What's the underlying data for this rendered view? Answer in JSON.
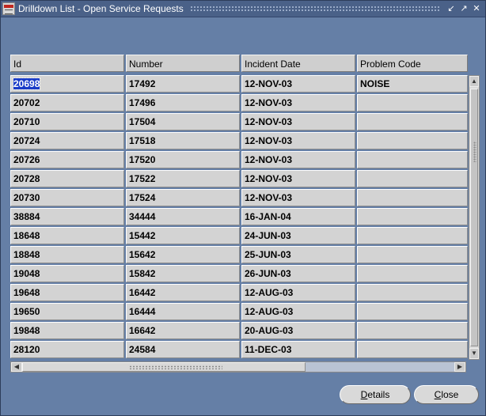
{
  "window": {
    "title": "Drilldown List - Open Service Requests",
    "controls": [
      "minimize",
      "maximize",
      "close"
    ]
  },
  "table": {
    "columns": [
      "Id",
      "Number",
      "Incident Date",
      "Problem Code"
    ],
    "rows": [
      {
        "id": "20698",
        "number": "17492",
        "incident_date": "12-NOV-03",
        "problem_code": "NOISE"
      },
      {
        "id": "20702",
        "number": "17496",
        "incident_date": "12-NOV-03",
        "problem_code": ""
      },
      {
        "id": "20710",
        "number": "17504",
        "incident_date": "12-NOV-03",
        "problem_code": ""
      },
      {
        "id": "20724",
        "number": "17518",
        "incident_date": "12-NOV-03",
        "problem_code": ""
      },
      {
        "id": "20726",
        "number": "17520",
        "incident_date": "12-NOV-03",
        "problem_code": ""
      },
      {
        "id": "20728",
        "number": "17522",
        "incident_date": "12-NOV-03",
        "problem_code": ""
      },
      {
        "id": "20730",
        "number": "17524",
        "incident_date": "12-NOV-03",
        "problem_code": ""
      },
      {
        "id": "38884",
        "number": "34444",
        "incident_date": "16-JAN-04",
        "problem_code": ""
      },
      {
        "id": "18648",
        "number": "15442",
        "incident_date": "24-JUN-03",
        "problem_code": ""
      },
      {
        "id": "18848",
        "number": "15642",
        "incident_date": "25-JUN-03",
        "problem_code": ""
      },
      {
        "id": "19048",
        "number": "15842",
        "incident_date": "26-JUN-03",
        "problem_code": ""
      },
      {
        "id": "19648",
        "number": "16442",
        "incident_date": "12-AUG-03",
        "problem_code": ""
      },
      {
        "id": "19650",
        "number": "16444",
        "incident_date": "12-AUG-03",
        "problem_code": ""
      },
      {
        "id": "19848",
        "number": "16642",
        "incident_date": "20-AUG-03",
        "problem_code": ""
      },
      {
        "id": "28120",
        "number": "24584",
        "incident_date": "11-DEC-03",
        "problem_code": ""
      }
    ],
    "selected_row": 0
  },
  "buttons": {
    "details": {
      "mnemonic": "D",
      "rest": "etails"
    },
    "close": {
      "mnemonic": "C",
      "rest": "lose"
    }
  },
  "colors": {
    "background": "#657fa6",
    "titlebar": "#4a6188",
    "cell": "#d3d3d3",
    "selection": "#1a3cc8"
  }
}
